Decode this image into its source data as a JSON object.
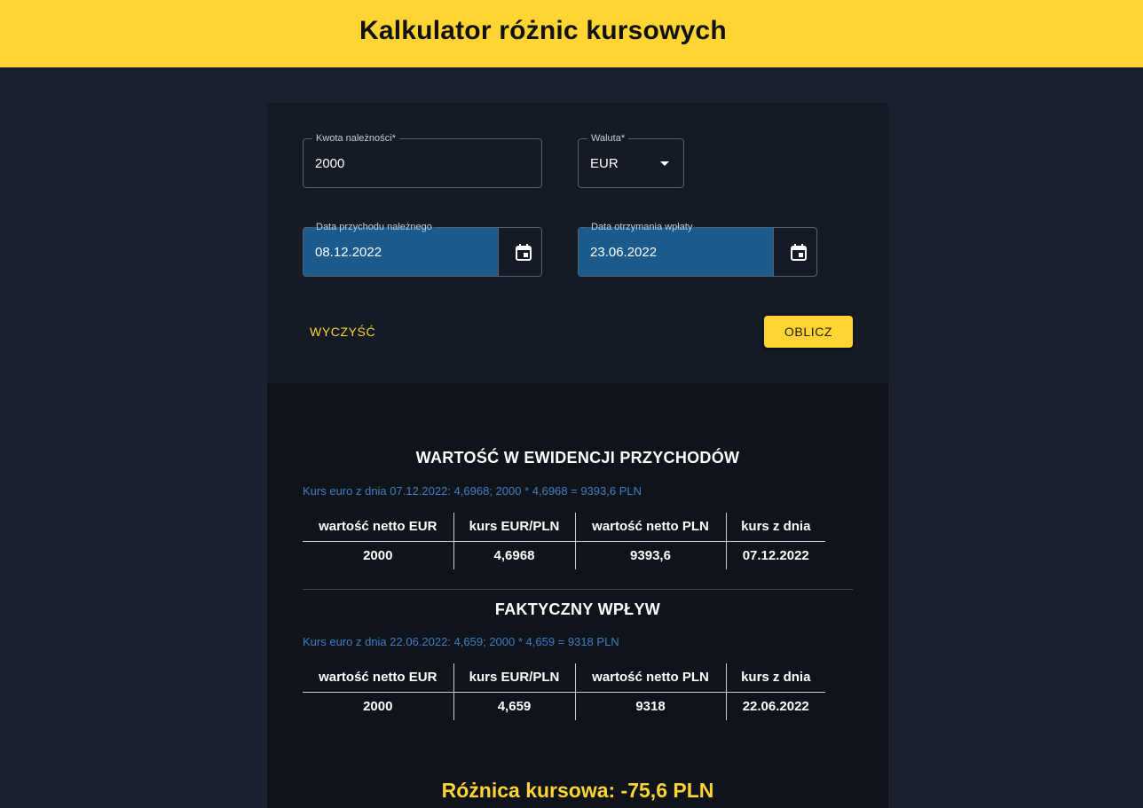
{
  "header": {
    "title": "Kalkulator różnic kursowych"
  },
  "form": {
    "amount": {
      "label": "Kwota należności",
      "required_mark": "*",
      "value": "2000"
    },
    "currency": {
      "label": "Waluta",
      "required_mark": "*",
      "value": "EUR"
    },
    "income_date": {
      "label": "Data przychodu należnego",
      "value": "08.12.2022"
    },
    "payment_date": {
      "label": "Data otrzymania wpłaty",
      "value": "23.06.2022"
    },
    "clear_label": "WYCZYŚĆ",
    "calculate_label": "OBLICZ"
  },
  "results": {
    "columns": [
      "wartość netto EUR",
      "kurs EUR/PLN",
      "wartość netto PLN",
      "kurs z dnia"
    ],
    "income_record": {
      "title": "WARTOŚĆ W EWIDENCJI PRZYCHODÓW",
      "note": "Kurs euro z dnia 07.12.2022: 4,6968; 2000 * 4,6968 = 9393,6 PLN",
      "row": [
        "2000",
        "4,6968",
        "9393,6",
        "07.12.2022"
      ]
    },
    "actual_inflow": {
      "title": "FAKTYCZNY WPŁYW",
      "note": "Kurs euro z dnia 22.06.2022: 4,659; 2000 * 4,659 = 9318 PLN",
      "row": [
        "2000",
        "4,659",
        "9318",
        "22.06.2022"
      ]
    },
    "difference": "Różnica kursowa: -75,6 PLN"
  },
  "colors": {
    "accent": "#ffd433",
    "date_fill": "#1a5a8c",
    "note": "#3f7ec2",
    "background": "#18212d"
  },
  "icons": {
    "calendar": "calendar-icon",
    "dropdown": "chevron-down-icon"
  }
}
